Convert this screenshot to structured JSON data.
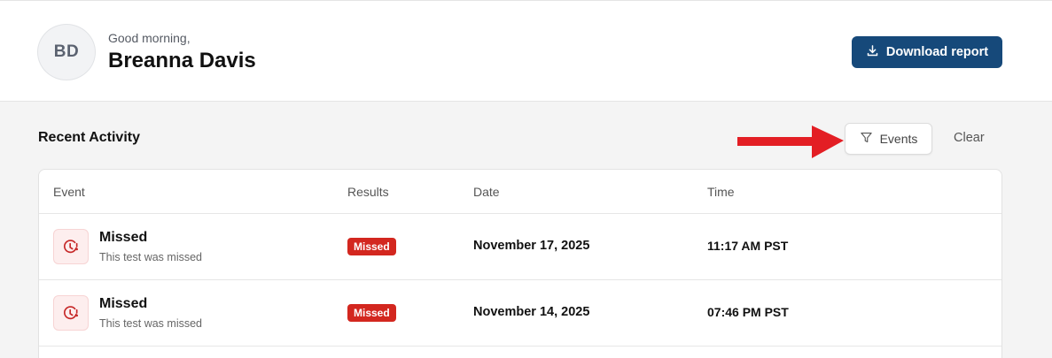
{
  "header": {
    "avatar_initials": "BD",
    "greeting": "Good morning,",
    "user_name": "Breanna Davis",
    "download_label": "Download report"
  },
  "activity": {
    "title": "Recent Activity",
    "filter_label": "Events",
    "clear_label": "Clear",
    "columns": [
      "Event",
      "Results",
      "Date",
      "Time"
    ],
    "rows": [
      {
        "event_title": "Missed",
        "event_subtitle": "This test was missed",
        "result_badge": "Missed",
        "date": "November 17, 2025",
        "time": "11:17 AM PST"
      },
      {
        "event_title": "Missed",
        "event_subtitle": "This test was missed",
        "result_badge": "Missed",
        "date": "November 14, 2025",
        "time": "07:46 PM PST"
      }
    ]
  },
  "colors": {
    "primary": "#16497a",
    "missed_badge": "#d3271f",
    "annotation_arrow": "#e31e24"
  },
  "icons": {
    "download": "download-icon",
    "filter": "filter-icon",
    "missed": "clock-alert-icon"
  }
}
